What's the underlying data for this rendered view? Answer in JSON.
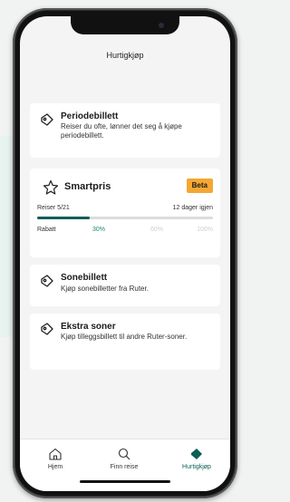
{
  "header": {
    "title": "Hurtigkjøp"
  },
  "cards": {
    "periode": {
      "title": "Periodebillett",
      "description": "Reiser du ofte, lønner det seg å kjøpe periodebillett.",
      "icon": "ticket-icon"
    },
    "smartpris": {
      "title": "Smartpris",
      "badge": "Beta",
      "trips_label": "Reiser 5/21",
      "days_left": "12 dager igjen",
      "progress_fraction": 0.3,
      "discount_label": "Rabatt",
      "tiers": [
        "30%",
        "60%",
        "100%"
      ],
      "active_tier": "30%",
      "icon": "star-icon"
    },
    "sone": {
      "title": "Sonebillett",
      "description": "Kjøp sonebilletter fra Ruter.",
      "icon": "ticket-icon"
    },
    "ekstra": {
      "title": "Ekstra soner",
      "description": "Kjøp tilleggsbillett til andre Ruter-soner.",
      "icon": "ticket-icon"
    }
  },
  "tabbar": {
    "home": "Hjem",
    "search": "Finn reise",
    "quick": "Hurtigkjøp",
    "active": "quick"
  },
  "colors": {
    "accent": "#0d5e56",
    "badge": "#f5a733",
    "active_tier": "#1a8a74"
  }
}
